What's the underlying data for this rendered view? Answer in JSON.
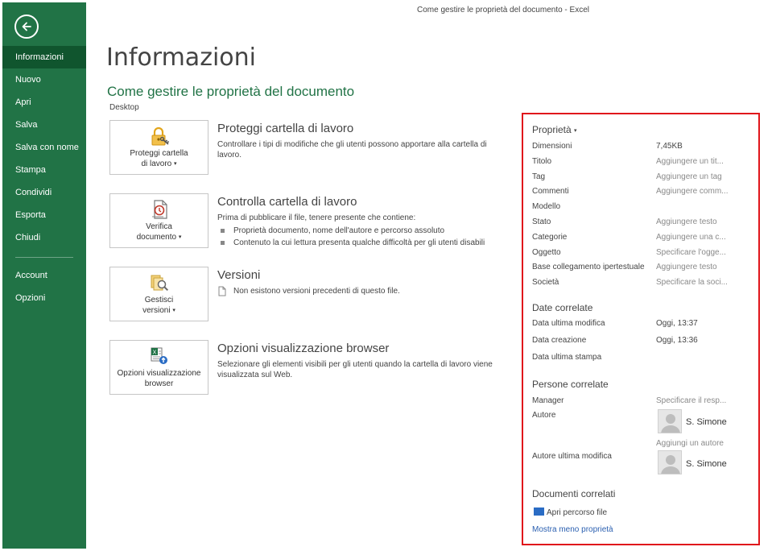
{
  "window": {
    "title": "Come gestire le proprietà del documento - Excel"
  },
  "sidebar": {
    "back_icon": "arrow-left-circle-icon",
    "items": [
      {
        "label": "Informazioni",
        "active": true
      },
      {
        "label": "Nuovo"
      },
      {
        "label": "Apri"
      },
      {
        "label": "Salva"
      },
      {
        "label": "Salva con nome"
      },
      {
        "label": "Stampa"
      },
      {
        "label": "Condividi"
      },
      {
        "label": "Esporta"
      },
      {
        "label": "Chiudi"
      }
    ],
    "bottom_items": [
      {
        "label": "Account"
      },
      {
        "label": "Opzioni"
      }
    ],
    "color": "#217346",
    "active_color": "#10552e"
  },
  "main": {
    "title": "Informazioni",
    "doc_title": "Come gestire le proprietà del documento",
    "location": "Desktop",
    "sections": [
      {
        "button_line1": "Proteggi cartella",
        "button_line2": "di lavoro",
        "icon": "lock-key-icon",
        "heading": "Proteggi cartella di lavoro",
        "text": "Controllare i tipi di modifiche che gli utenti possono apportare alla cartella di lavoro."
      },
      {
        "button_line1": "Verifica",
        "button_line2": "documento",
        "icon": "inspect-document-icon",
        "heading": "Controlla cartella di lavoro",
        "text": "Prima di pubblicare il file, tenere presente che contiene:",
        "bullets": [
          "Proprietà documento, nome dell'autore e percorso assoluto",
          "Contenuto la cui lettura presenta qualche difficoltà per gli utenti disabili"
        ]
      },
      {
        "button_line1": "Gestisci",
        "button_line2": "versioni",
        "icon": "manage-versions-icon",
        "heading": "Versioni",
        "text": "Non esistono versioni precedenti di questo file."
      },
      {
        "button_line1": "Opzioni visualizzazione",
        "button_line2": "browser",
        "icon": "browser-view-icon",
        "heading": "Opzioni visualizzazione browser",
        "text": "Selezionare gli elementi visibili per gli utenti quando la cartella di lavoro viene visualizzata sul Web."
      }
    ]
  },
  "properties": {
    "heading": "Proprietà",
    "rows": [
      {
        "label": "Dimensioni",
        "value": "7,45KB",
        "muted": false
      },
      {
        "label": "Titolo",
        "value": "Aggiungere un tit...",
        "muted": true
      },
      {
        "label": "Tag",
        "value": "Aggiungere un tag",
        "muted": true
      },
      {
        "label": "Commenti",
        "value": "Aggiungere comm...",
        "muted": true
      },
      {
        "label": "Modello",
        "value": "",
        "muted": true
      },
      {
        "label": "Stato",
        "value": "Aggiungere testo",
        "muted": true
      },
      {
        "label": "Categorie",
        "value": "Aggiungere una c...",
        "muted": true
      },
      {
        "label": "Oggetto",
        "value": "Specificare l'ogge...",
        "muted": true
      },
      {
        "label": "Base collegamento ipertestuale",
        "value": "Aggiungere testo",
        "muted": true
      },
      {
        "label": "Società",
        "value": "Specificare la soci...",
        "muted": true
      }
    ],
    "dates": {
      "heading": "Date correlate",
      "rows": [
        {
          "label": "Data ultima modifica",
          "value": "Oggi, 13:37"
        },
        {
          "label": "Data creazione",
          "value": "Oggi, 13:36"
        },
        {
          "label": "Data ultima stampa",
          "value": ""
        }
      ]
    },
    "people": {
      "heading": "Persone correlate",
      "manager_label": "Manager",
      "manager_value": "Specificare il resp...",
      "author_label": "Autore",
      "author_name": "S. Simone",
      "add_author": "Aggiungi un autore",
      "last_modified_label": "Autore ultima modifica",
      "last_modified_name": "S. Simone"
    },
    "documents": {
      "heading": "Documenti correlati",
      "open_path": "Apri percorso file"
    },
    "show_less": "Mostra meno proprietà",
    "border_color": "#e0151b"
  }
}
